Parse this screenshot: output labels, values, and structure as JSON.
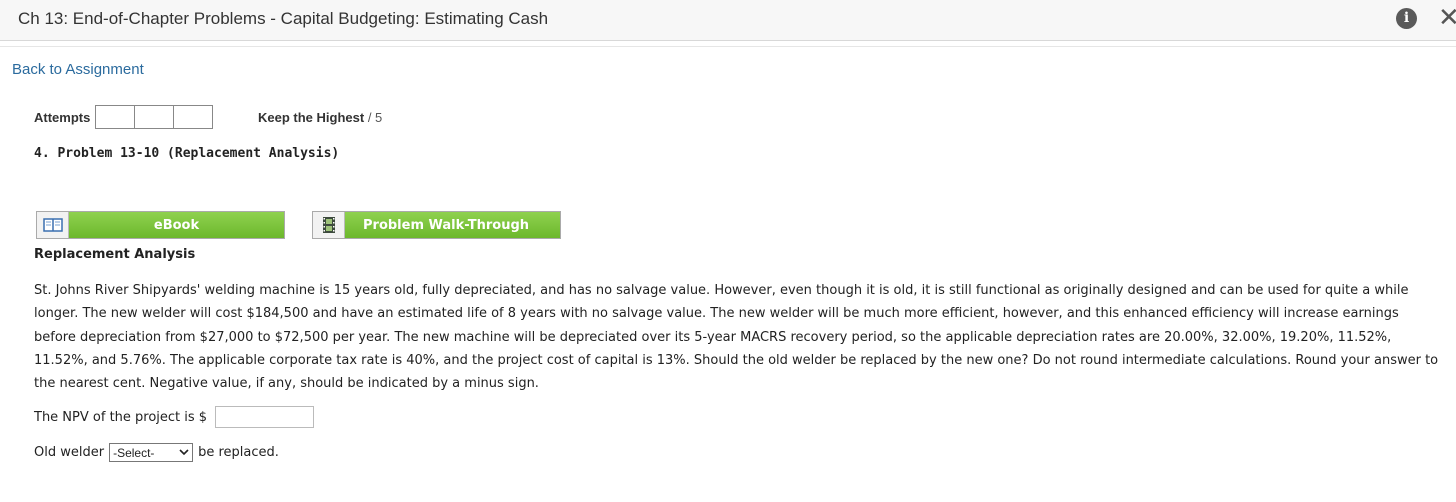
{
  "header": {
    "title": "Ch 13: End-of-Chapter Problems - Capital Budgeting: Estimating Cash",
    "info_icon": "info-icon",
    "info_glyph": "i",
    "close_icon": "close-icon",
    "close_glyph": "✕"
  },
  "nav": {
    "back_link": "Back to Assignment"
  },
  "attempts": {
    "label": "Attempts",
    "boxes": [
      "",
      "",
      ""
    ],
    "keep_label": "Keep the Highest",
    "score": "/ 5"
  },
  "problem": {
    "title": "4.  Problem 13-10 (Replacement Analysis)",
    "buttons": {
      "ebook": {
        "label": "eBook",
        "icon": "book-icon"
      },
      "walkthrough": {
        "label": "Problem Walk-Through",
        "icon": "film-icon"
      }
    },
    "heading": "Replacement Analysis",
    "text": "St. Johns River Shipyards' welding machine is 15 years old, fully depreciated, and has no salvage value. However, even though it is old, it is still functional as originally designed and can be used for quite a while longer. The new welder will cost $184,500 and have an estimated life of 8 years with no salvage value. The new welder will be much more efficient, however, and this enhanced efficiency will increase earnings before depreciation from $27,000 to $72,500 per year. The new machine will be depreciated over its 5-year MACRS recovery period, so the applicable depreciation rates are 20.00%, 32.00%, 19.20%, 11.52%, 11.52%, and 5.76%. The applicable corporate tax rate is 40%, and the project cost of capital is 13%. Should the old welder be replaced by the new one? Do not round intermediate calculations. Round your answer to the nearest cent. Negative value, if any, should be indicated by a minus sign."
  },
  "answers": {
    "npv_label": "The NPV of the project is $",
    "npv_value": "",
    "welder_prefix": "Old welder",
    "welder_select": "-Select-",
    "welder_suffix": "be replaced."
  },
  "colors": {
    "button_green": "#7ac143",
    "link_blue": "#2b6b9e"
  }
}
